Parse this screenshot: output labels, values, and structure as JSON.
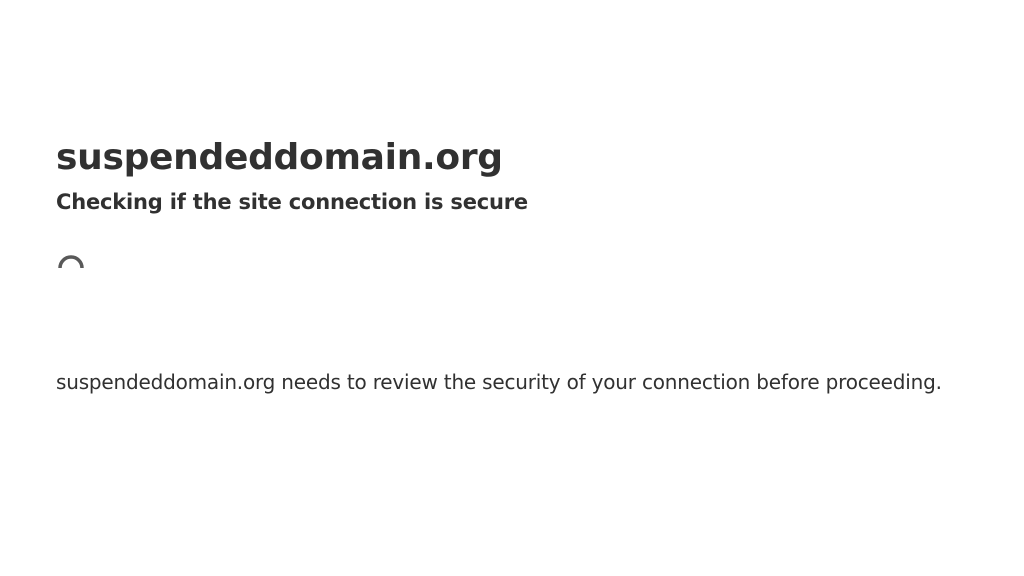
{
  "page": {
    "site_title": "suspendeddomain.org",
    "subtitle": "Checking if the site connection is secure",
    "message": "suspendeddomain.org needs to review the security of your connection before proceeding."
  },
  "spinner": {
    "icon": "loading-spinner-icon",
    "color": "#595959"
  }
}
